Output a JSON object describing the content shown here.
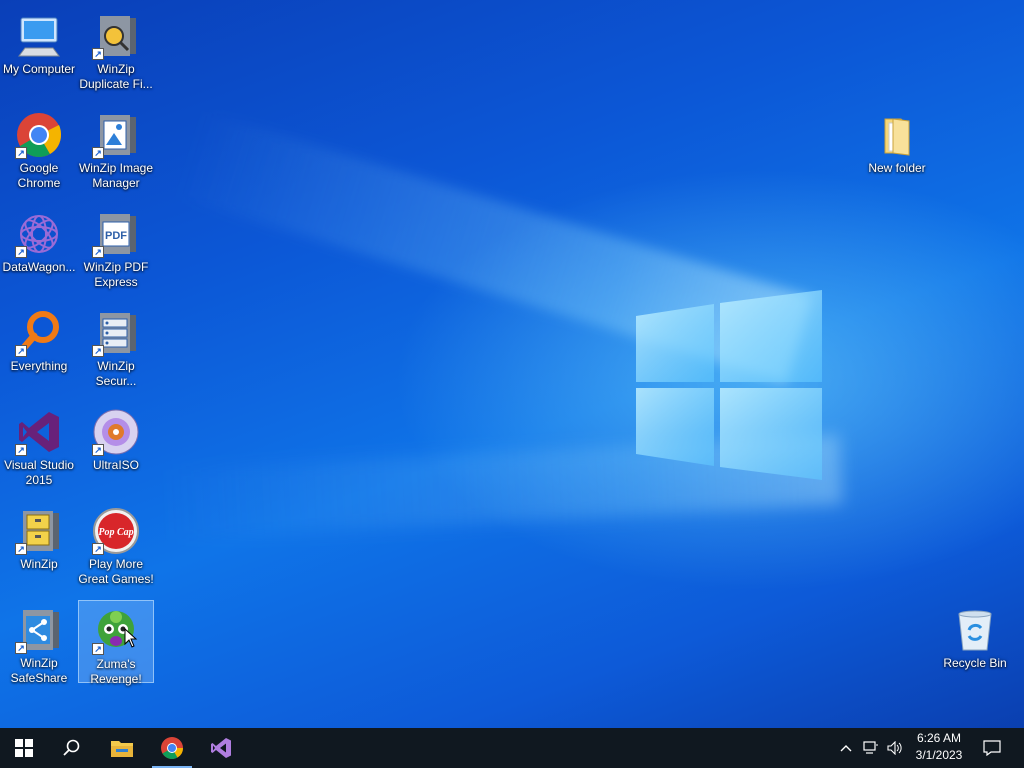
{
  "desktop": {
    "icons": [
      {
        "label": "My Computer",
        "icon": "computer-icon"
      },
      {
        "label": "WinZip Duplicate Fi...",
        "icon": "winzip-duplicate-icon"
      },
      {
        "label": "Google Chrome",
        "icon": "chrome-icon"
      },
      {
        "label": "WinZip Image Manager",
        "icon": "winzip-image-icon"
      },
      {
        "label": "DataWagon...",
        "icon": "datawagon-icon"
      },
      {
        "label": "WinZip PDF Express",
        "icon": "winzip-pdf-icon"
      },
      {
        "label": "Everything",
        "icon": "everything-search-icon"
      },
      {
        "label": "WinZip Secur...",
        "icon": "winzip-secure-icon"
      },
      {
        "label": "Visual Studio 2015",
        "icon": "visual-studio-icon"
      },
      {
        "label": "UltraISO",
        "icon": "ultraiso-disc-icon"
      },
      {
        "label": "WinZip",
        "icon": "winzip-icon"
      },
      {
        "label": "Play More Great Games!",
        "icon": "popcap-icon"
      },
      {
        "label": "WinZip SafeShare",
        "icon": "winzip-safeshare-icon"
      },
      {
        "label": "Zuma's Revenge!",
        "icon": "zuma-icon"
      },
      {
        "label": "New folder",
        "icon": "folder-icon"
      },
      {
        "label": "Recycle Bin",
        "icon": "recycle-bin-icon"
      }
    ],
    "pdf_badge": "PDF",
    "popcap_badge": "Pop Cap"
  },
  "taskbar": {
    "pinned": [
      "start-icon",
      "search-icon",
      "file-explorer-icon",
      "chrome-icon",
      "visual-studio-icon"
    ],
    "tray": [
      "chevron-up-icon",
      "network-icon",
      "volume-icon"
    ],
    "time": "6:26 AM",
    "date": "3/1/2023",
    "notification": "action-center-icon"
  },
  "colors": {
    "taskbar": "#101820",
    "accent": "#0f74e8"
  }
}
